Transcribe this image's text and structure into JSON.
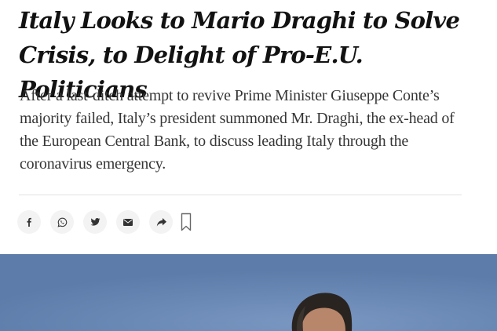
{
  "article": {
    "headline_line1": "Italy Looks to Mario Draghi to Solve",
    "headline_line2": "Crisis, to Delight of Pro-E.U. Politicians",
    "summary": "After a last-ditch attempt to revive Prime Minister Giuseppe Conte’s majority failed, Italy’s president summoned Mr. Draghi, the ex-head of the European Central Bank, to discuss leading Italy through the coronavirus emergency."
  },
  "share_bar": {
    "buttons": [
      {
        "icon": "facebook-icon"
      },
      {
        "icon": "whatsapp-icon"
      },
      {
        "icon": "twitter-icon"
      },
      {
        "icon": "email-icon"
      },
      {
        "icon": "share-icon"
      }
    ],
    "bookmark_icon": "bookmark-icon"
  },
  "colors": {
    "headline": "#121212",
    "summary": "#363636",
    "button_bg": "#f3f3f3",
    "photo_background": "#6a88b4"
  }
}
